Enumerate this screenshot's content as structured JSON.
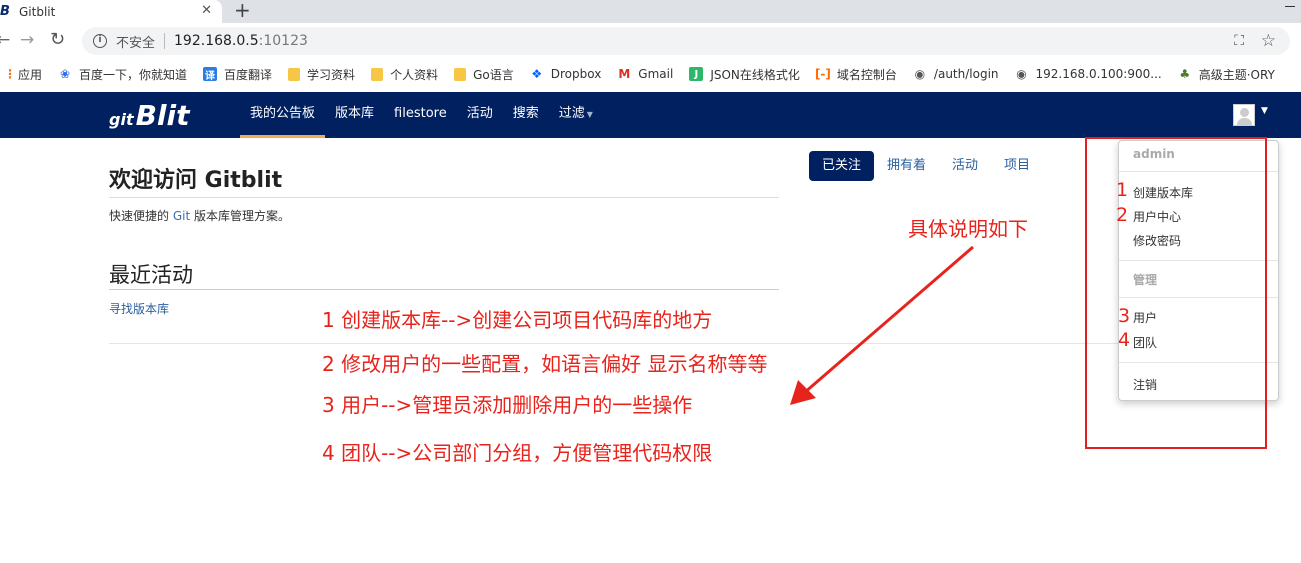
{
  "browser": {
    "tab_title": "Gitblit",
    "tab_favicon": "B",
    "close_glyph": "✕",
    "new_tab_glyph": "+",
    "insecure_label": "不安全",
    "url_host": "192.168.0.5",
    "url_port": ":10123"
  },
  "bookmarks": [
    {
      "label": "应用",
      "icon": "apps-icon",
      "color": "#e8711a"
    },
    {
      "label": "百度一下，你就知道",
      "icon": "baidu-paw-icon",
      "color": "#2d6be4"
    },
    {
      "label": "百度翻译",
      "icon": "translate-icon",
      "color": "#2a7de1"
    },
    {
      "label": "学习资料",
      "icon": "folder-icon",
      "color": "#f6c744"
    },
    {
      "label": "个人资料",
      "icon": "folder-icon",
      "color": "#f6c744"
    },
    {
      "label": "Go语言",
      "icon": "folder-icon",
      "color": "#f6c744"
    },
    {
      "label": "Dropbox",
      "icon": "dropbox-icon",
      "color": "#0061fe"
    },
    {
      "label": "Gmail",
      "icon": "gmail-icon",
      "color": "#d93025"
    },
    {
      "label": "JSON在线格式化",
      "icon": "json-icon",
      "color": "#2eb86b"
    },
    {
      "label": "域名控制台",
      "icon": "aliyun-icon",
      "color": "#ff6a00"
    },
    {
      "label": "/auth/login",
      "icon": "globe-icon",
      "color": "#555555"
    },
    {
      "label": "192.168.0.100:900...",
      "icon": "globe-icon",
      "color": "#555555"
    },
    {
      "label": "高级主题·ORY",
      "icon": "tree-icon",
      "color": "#4a7a2a"
    }
  ],
  "navbar": {
    "logo_prefix": "git",
    "logo": "Blit",
    "items": [
      "我的公告板",
      "版本库",
      "filestore",
      "活动",
      "搜索",
      "过滤"
    ],
    "active_index": 0
  },
  "main": {
    "welcome": "欢迎访问 Gitblit",
    "tagline_prefix": "快速便捷的 ",
    "tagline_git": "Git",
    "tagline_suffix": " 版本库管理方案。",
    "recent_activity": "最近活动",
    "find_repos": "寻找版本库",
    "pills": [
      "已关注",
      "拥有着",
      "活动",
      "项目"
    ],
    "active_pill": 0
  },
  "dropdown": {
    "user_header": "admin",
    "create_repo": "创建版本库",
    "user_center": "用户中心",
    "change_password": "修改密码",
    "admin_header": "管理",
    "users": "用户",
    "teams": "团队",
    "logout": "注销"
  },
  "annotations": {
    "title": "具体说明如下",
    "line1": "1 创建版本库-->创建公司项目代码库的地方",
    "line2": "2 修改用户的一些配置，如语言偏好 显示名称等等",
    "line3": "3 用户-->管理员添加删除用户的一些操作",
    "line4": "4 团队-->公司部门分组，方便管理代码权限",
    "num1": "1",
    "num2": "2",
    "num3": "3",
    "num4": "4",
    "color": "#e8231b"
  }
}
